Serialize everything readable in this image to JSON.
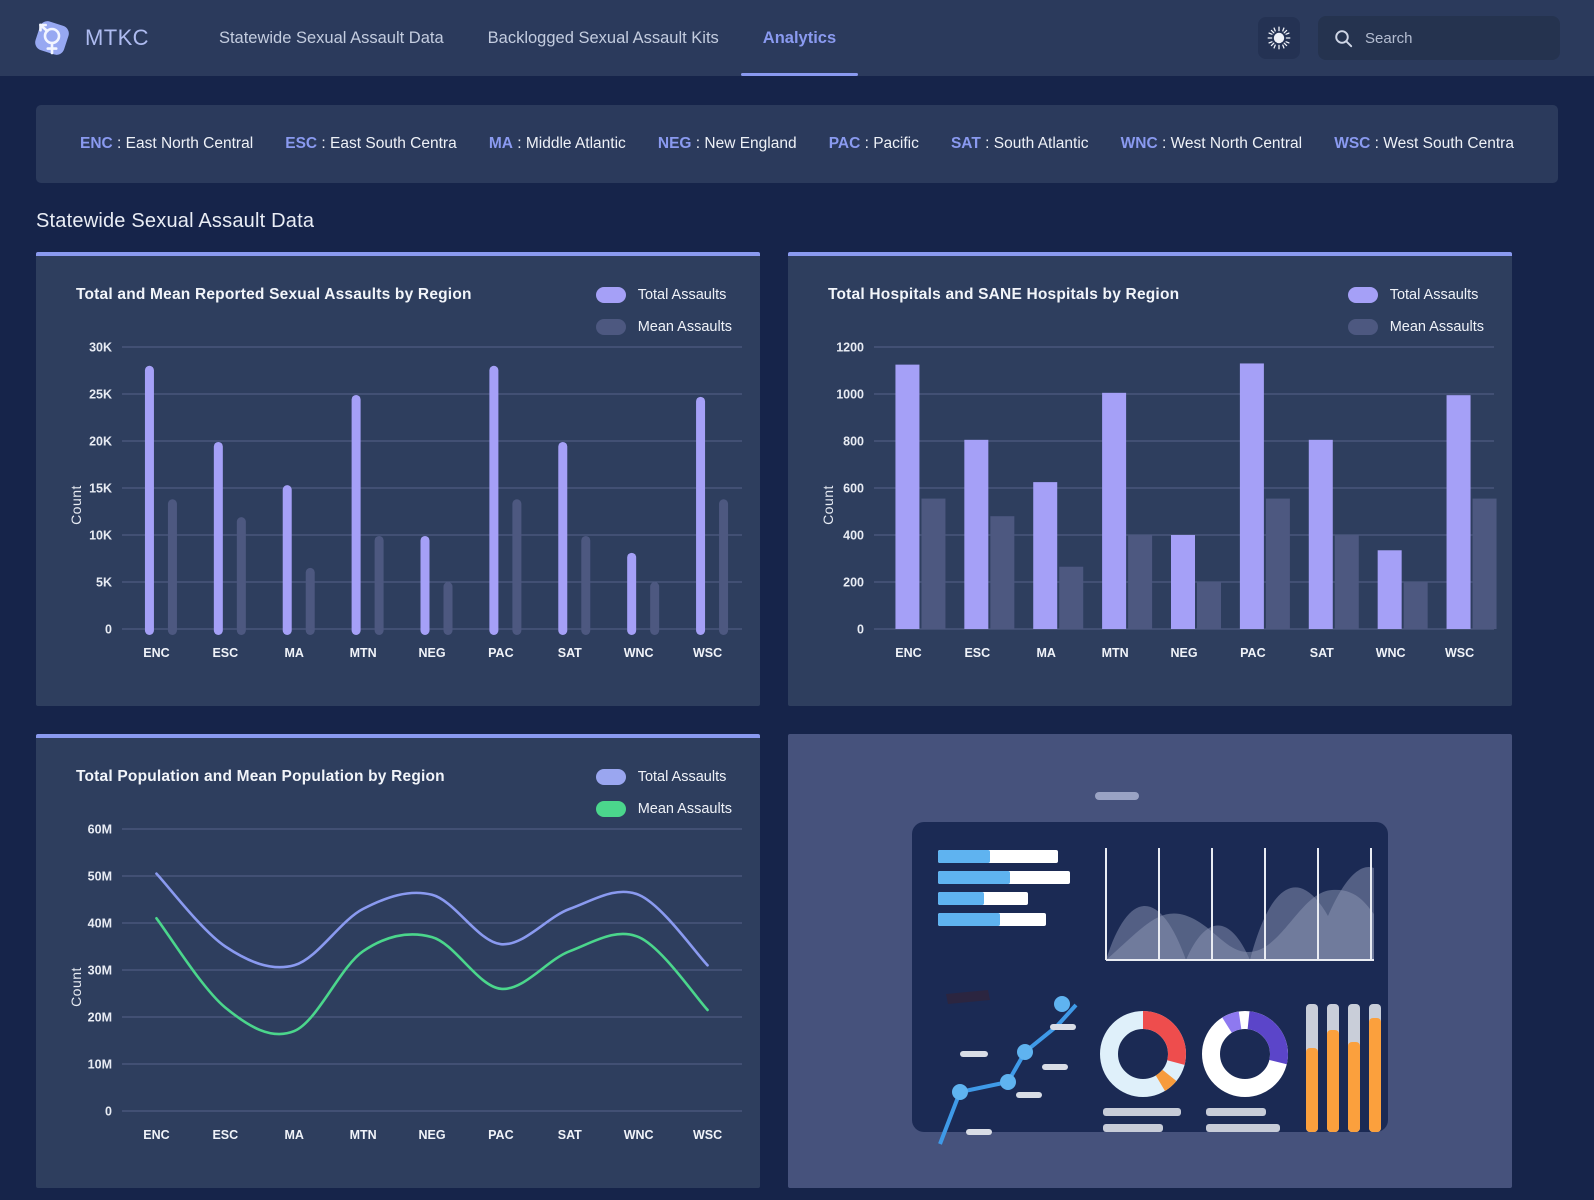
{
  "header": {
    "brand": "MTKC",
    "logo_icon": "gender-symbol-icon",
    "tabs": [
      {
        "label": "Statewide Sexual Assault Data",
        "active": false
      },
      {
        "label": "Backlogged Sexual Assault Kits",
        "active": false
      },
      {
        "label": "Analytics",
        "active": true
      }
    ],
    "theme_toggle_icon": "sun-icon",
    "search": {
      "icon": "search-icon",
      "placeholder": "Search",
      "value": ""
    }
  },
  "abbrev_legend": [
    {
      "code": "ENC",
      "name": "East North Central"
    },
    {
      "code": "ESC",
      "name": "East South Centra"
    },
    {
      "code": "MA",
      "name": "Middle Atlantic"
    },
    {
      "code": "NEG",
      "name": "New England"
    },
    {
      "code": "PAC",
      "name": "Pacific"
    },
    {
      "code": "SAT",
      "name": "South Atlantic"
    },
    {
      "code": "WNC",
      "name": "West North Central"
    },
    {
      "code": "WSC",
      "name": "West South Centra"
    }
  ],
  "section_title": "Statewide Sexual Assault Data",
  "colors": {
    "accent": "#8a9af0",
    "series_total": "#a5a0f7",
    "series_mean": "#4d5880",
    "series_mean_green": "#4bd68c",
    "page_bg": "#16244a",
    "card_bg": "#2e3e5e",
    "nav_bg": "#2b3a5c"
  },
  "chart_data": [
    {
      "type": "bar",
      "title": "Total and Mean Reported Sexual Assaults by Region",
      "xlabel": "",
      "ylabel": "Count",
      "categories": [
        "ENC",
        "ESC",
        "MA",
        "MTN",
        "NEG",
        "PAC",
        "SAT",
        "WNC",
        "WSC"
      ],
      "ytick_labels": [
        "0",
        "5K",
        "10K",
        "15K",
        "20K",
        "25K",
        "30K"
      ],
      "ylim": [
        0,
        30000
      ],
      "grid": true,
      "legend_position": "top-right",
      "series": [
        {
          "name": "Total Assaults",
          "color": "#a5a0f7",
          "values": [
            28000,
            19900,
            15300,
            24900,
            9900,
            28000,
            19900,
            8100,
            24700
          ]
        },
        {
          "name": "Mean Assaults",
          "color": "#4d5880",
          "values": [
            13800,
            11900,
            6500,
            9900,
            5000,
            13800,
            9900,
            5000,
            13800
          ]
        }
      ]
    },
    {
      "type": "bar",
      "title": "Total Hospitals and SANE Hospitals by Region",
      "xlabel": "",
      "ylabel": "Count",
      "categories": [
        "ENC",
        "ESC",
        "MA",
        "MTN",
        "NEG",
        "PAC",
        "SAT",
        "WNC",
        "WSC"
      ],
      "ytick_labels": [
        "0",
        "200",
        "400",
        "600",
        "800",
        "1000",
        "1200"
      ],
      "ylim": [
        0,
        1200
      ],
      "grid": true,
      "legend_position": "top-right",
      "series": [
        {
          "name": "Total Assaults",
          "color": "#a5a0f7",
          "values": [
            1125,
            805,
            625,
            1005,
            400,
            1130,
            805,
            335,
            995
          ]
        },
        {
          "name": "Mean Assaults",
          "color": "#4d5880",
          "values": [
            555,
            480,
            265,
            400,
            200,
            555,
            400,
            200,
            555
          ]
        }
      ]
    },
    {
      "type": "line",
      "title": "Total Population and Mean Population by Region",
      "xlabel": "",
      "ylabel": "Count",
      "categories": [
        "ENC",
        "ESC",
        "MA",
        "MTN",
        "NEG",
        "PAC",
        "SAT",
        "WNC",
        "WSC"
      ],
      "ytick_labels": [
        "0",
        "10M",
        "20M",
        "30M",
        "40M",
        "50M",
        "60M"
      ],
      "ylim": [
        0,
        60000000
      ],
      "grid": true,
      "legend_position": "top-right",
      "series": [
        {
          "name": "Total Assaults",
          "color": "#8a9af0",
          "values": [
            50500000,
            35000000,
            31000000,
            43000000,
            46000000,
            35500000,
            43000000,
            46000000,
            31000000
          ]
        },
        {
          "name": "Mean Assaults",
          "color": "#4bd68c",
          "values": [
            41000000,
            22000000,
            17000000,
            34000000,
            37000000,
            26000000,
            34000000,
            37000000,
            21500000
          ]
        }
      ]
    }
  ],
  "illustration": {
    "name": "analytics-dashboard-illustration"
  }
}
